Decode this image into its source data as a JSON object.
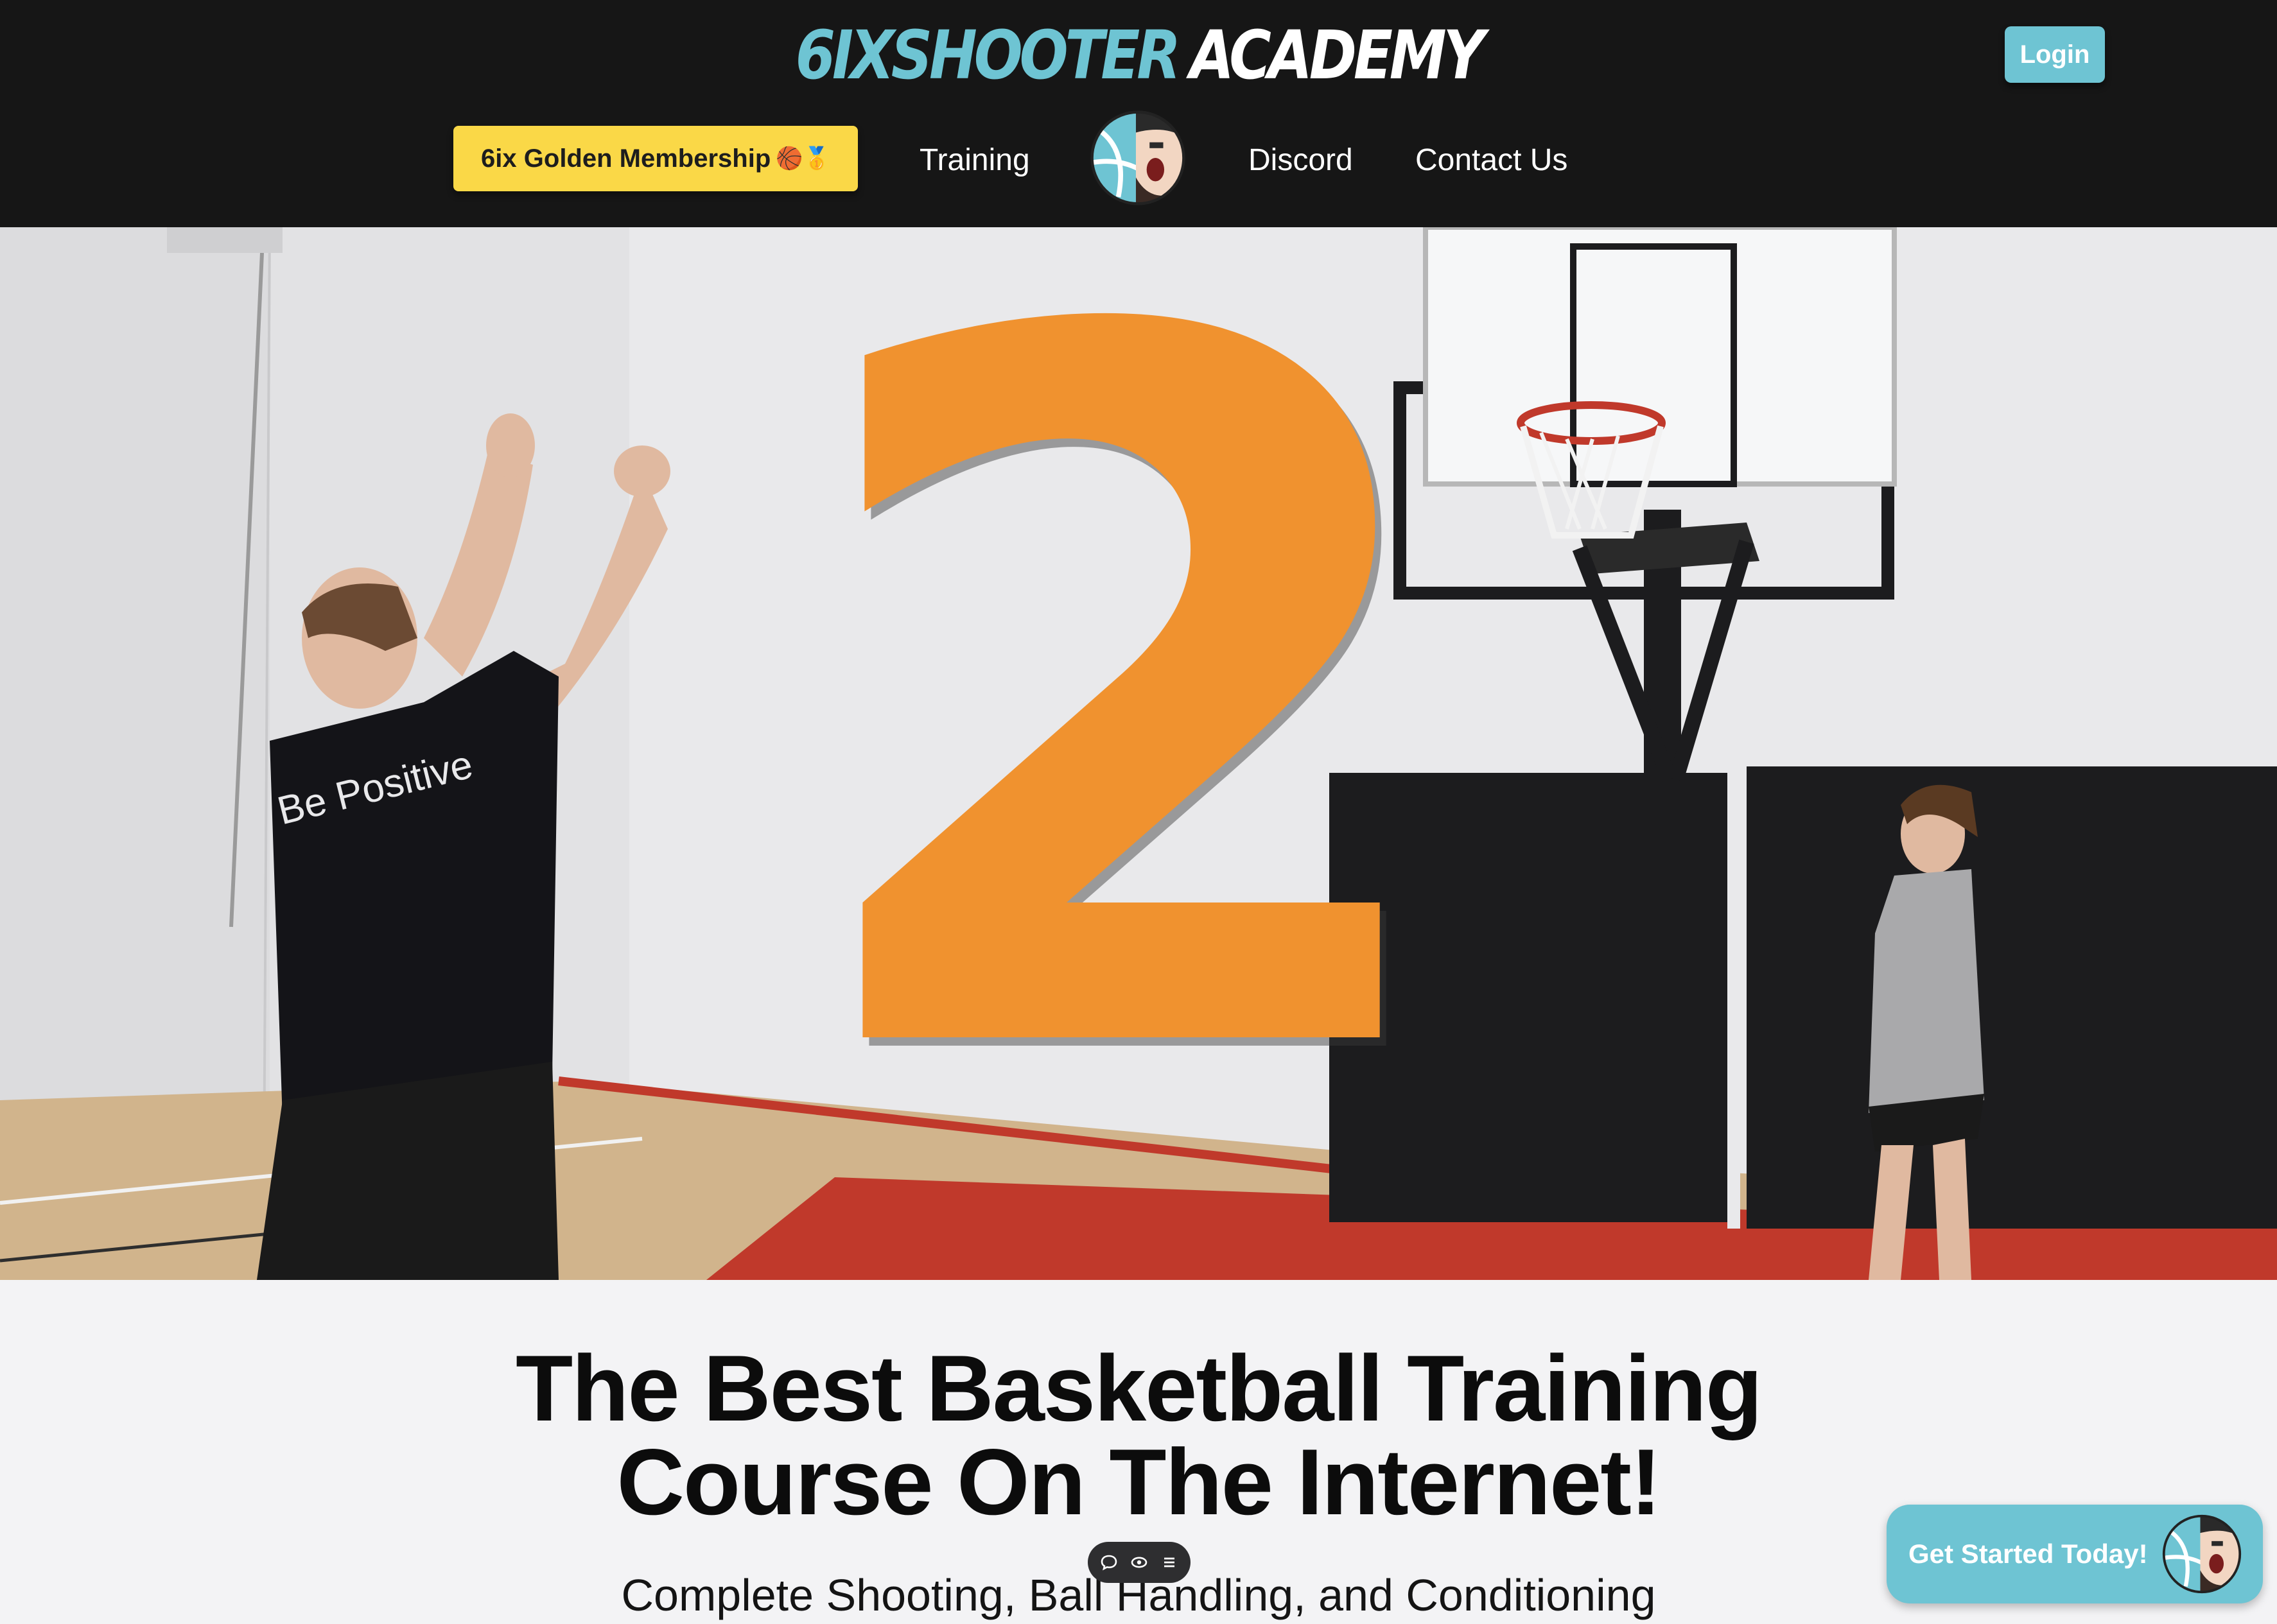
{
  "header": {
    "brand_part1": "6IXSHOOTER",
    "brand_part2": "ACADEMY",
    "login_label": "Login"
  },
  "nav": {
    "golden_label": "6ix Golden Membership",
    "golden_emoji": "🏀🥇",
    "training": "Training",
    "discord": "Discord",
    "contact": "Contact Us",
    "logo_icon": "shooter-logo-icon"
  },
  "hero": {
    "overlay_number": "2",
    "shirt_text": "Be Positive",
    "mute_icon": "speaker-muted-icon",
    "colors": {
      "overlay": "#f0922f",
      "court_red": "#c0392b",
      "wall_pad": "#1c1c1e"
    }
  },
  "main": {
    "headline_line1": "The Best Basketball Training",
    "headline_line2": "Course On The Internet!",
    "subheadline": "Complete Shooting, Ball Handling, and Conditioning"
  },
  "toolbar": {
    "icons": [
      "comment-icon",
      "eye-icon",
      "list-icon"
    ]
  },
  "cta": {
    "label": "Get Started Today!",
    "avatar_icon": "shooter-logo-icon"
  },
  "colors": {
    "accent": "#6ec4d3",
    "gold": "#fad847",
    "header_bg": "#161616",
    "page_bg": "#f3f3f5"
  }
}
